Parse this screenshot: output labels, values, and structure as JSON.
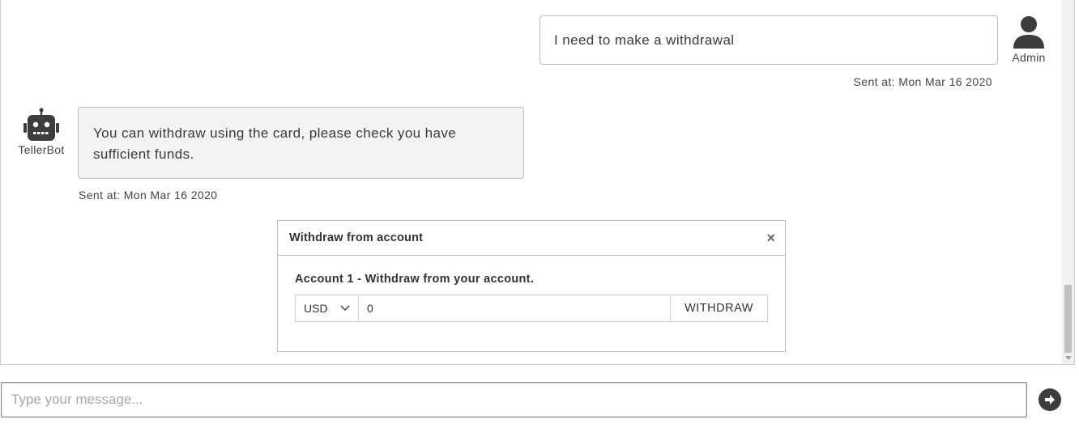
{
  "messages": {
    "admin": {
      "text": "I need to make a withdrawal",
      "author": "Admin",
      "sent": "Sent at: Mon Mar 16 2020",
      "icon": "user-icon"
    },
    "bot": {
      "text": "You can withdraw using the card, please check you have sufficient funds.",
      "author": "TellerBot",
      "sent": "Sent at: Mon Mar 16 2020",
      "icon": "robot-icon"
    }
  },
  "withdraw_card": {
    "title": "Withdraw from account",
    "close_label": "×",
    "account_line": "Account 1 - Withdraw from your account.",
    "currency": "USD",
    "amount": "0",
    "button_label": "WITHDRAW"
  },
  "composer": {
    "placeholder": "Type your message...",
    "value": "",
    "send_icon": "arrow-right-circle-icon"
  },
  "colors": {
    "bot_bubble_bg": "#f3f3f3",
    "icon_dark": "#3d3d3d"
  }
}
